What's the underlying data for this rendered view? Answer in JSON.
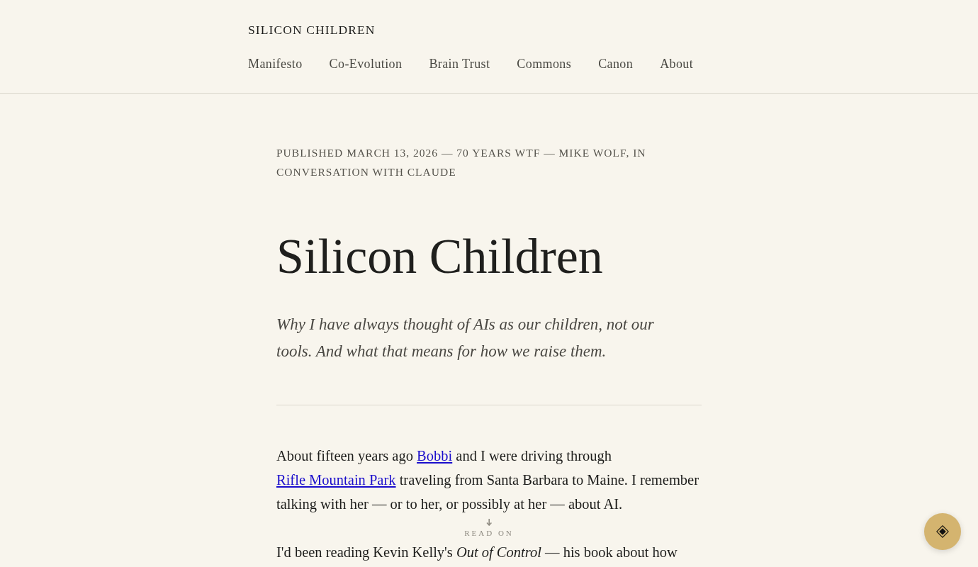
{
  "header": {
    "site_title": "SILICON CHILDREN",
    "nav": [
      "Manifesto",
      "Co-Evolution",
      "Brain Trust",
      "Commons",
      "Canon",
      "About"
    ]
  },
  "article": {
    "meta": "PUBLISHED MARCH 13, 2026 — 70 YEARS WTF — MIKE WOLF, IN CONVERSATION WITH CLAUDE",
    "title": "Silicon Children",
    "subtitle": "Why I have always thought of AIs as our children, not our tools. And what that means for how we raise them.",
    "paragraphs": [
      {
        "segments": [
          {
            "kind": "text",
            "text": "About fifteen years ago "
          },
          {
            "kind": "link",
            "text": "Bobbi"
          },
          {
            "kind": "text",
            "text": " and I were driving through "
          },
          {
            "kind": "link",
            "text": "Rifle Mountain Park"
          },
          {
            "kind": "text",
            "text": " traveling from Santa Barbara to Maine. I remember talking with her — or to her, or possibly at her — about AI."
          }
        ]
      },
      {
        "segments": [
          {
            "kind": "text",
            "text": "I'd been reading Kevin Kelly's *Out of Control* — his book about how"
          }
        ]
      }
    ]
  },
  "scroll_hint": {
    "label": "READ ON"
  }
}
